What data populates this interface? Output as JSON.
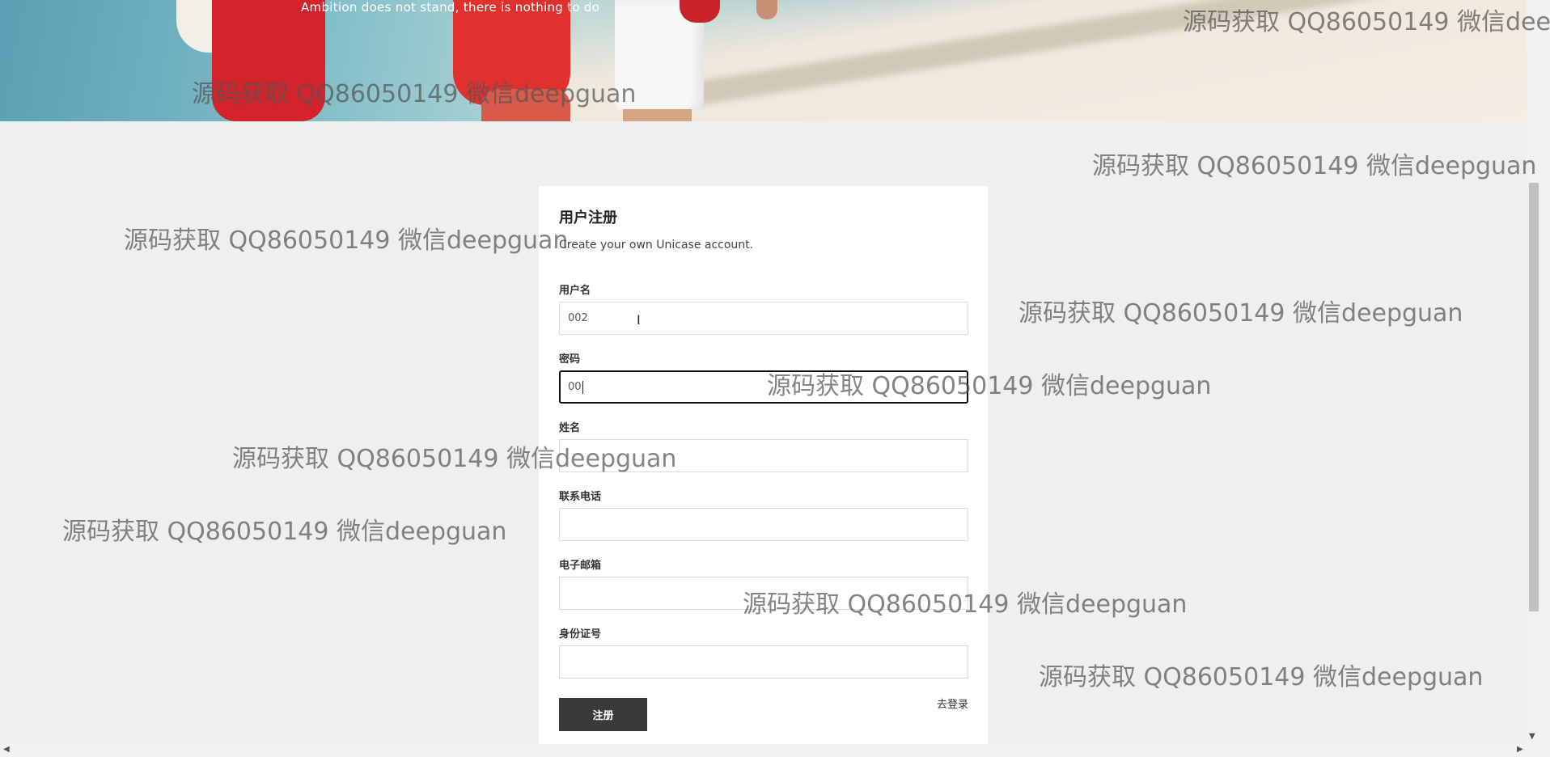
{
  "hero": {
    "tagline": "Ambition does not stand, there is nothing to do"
  },
  "form": {
    "title": "用户注册",
    "subtitle": "Create your own Unicase account.",
    "fields": [
      {
        "label": "用户名",
        "value": "002"
      },
      {
        "label": "密码",
        "value": "00"
      },
      {
        "label": "姓名",
        "value": ""
      },
      {
        "label": "联系电话",
        "value": ""
      },
      {
        "label": "电子邮箱",
        "value": ""
      },
      {
        "label": "身份证号",
        "value": ""
      }
    ],
    "submit_label": "注册",
    "login_link": "去登录"
  },
  "watermark": "源码获取 QQ86050149 微信deepguan"
}
